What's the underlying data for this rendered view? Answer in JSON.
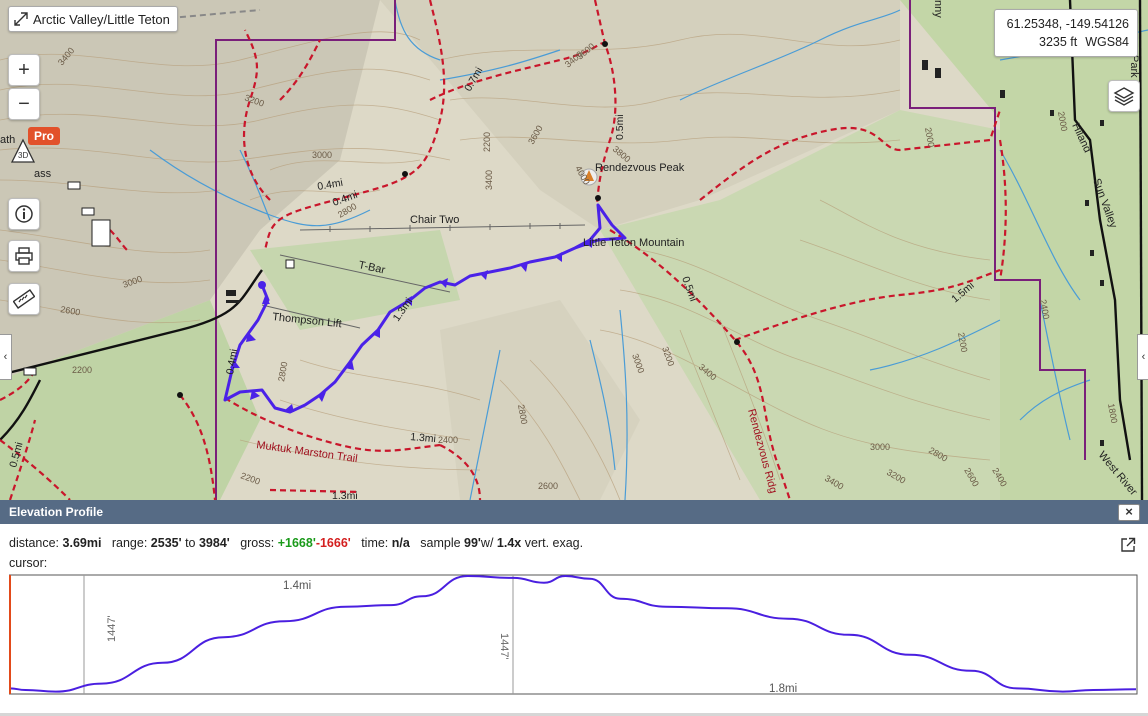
{
  "map": {
    "title": "Arctic Valley/Little Teton",
    "coords": {
      "latlon": "61.25348, -149.54126",
      "elevation": "3235 ft",
      "datum": "WGS84"
    },
    "controls": {
      "zoom_in": "+",
      "zoom_out": "−",
      "pro_badge": "Pro",
      "three_d": "3D"
    },
    "labels": {
      "rendezvous_peak": "Rendezvous Peak",
      "little_teton": "Little Teton Mountain",
      "chair_two": "Chair Two",
      "t_bar": "T-Bar",
      "thompson_lift": "Thompson Lift",
      "muktuk_trail": "Muktuk Marston Trail",
      "rendezvous_ridge": "Rendezvous Ridg",
      "hiland": "Hiland",
      "sun_valley": "Sun Valley",
      "west_river": "West River",
      "nny": "nny",
      "park": "Park",
      "ass": "ass",
      "ath": "ath"
    },
    "distance_labels": [
      "0.7mi",
      "0.5mi",
      "0.4mi",
      "0.4mi",
      "1.3mi",
      "0.4mi",
      "0.5mi",
      "1.5mi",
      "1.3mi",
      "1.3mi",
      "0.5mi"
    ],
    "contour_labels": [
      "3400",
      "3200",
      "3000",
      "2800",
      "3600",
      "3400",
      "3800",
      "4000",
      "3000",
      "2600",
      "2200",
      "2800",
      "3000",
      "3200",
      "3400",
      "2800",
      "2600",
      "2000",
      "2000",
      "2200",
      "2400",
      "1800",
      "3000",
      "2800",
      "2600",
      "2400",
      "2400",
      "3400",
      "3200",
      "2200",
      "2200",
      "3400",
      "3600"
    ]
  },
  "elevation_panel": {
    "title": "Elevation Profile",
    "close": "×",
    "stats": {
      "distance_label": "distance:",
      "distance": "3.69mi",
      "range_label": "range:",
      "range_low": "2535'",
      "range_to": "to",
      "range_high": "3984'",
      "gross_label": "gross:",
      "gain": "+1668'",
      "loss": "-1666'",
      "time_label": "time:",
      "time": "n/a",
      "sample_label": "sample",
      "sample": "99'",
      "sample_w": "w/",
      "exag": "1.4x",
      "exag_label": "vert. exag."
    },
    "cursor_label": "cursor:"
  },
  "chart_data": {
    "type": "line",
    "title": "",
    "xlabel": "",
    "ylabel": "",
    "ylim": [
      2535,
      3984
    ],
    "annotations": {
      "segment1_distance": "1.4mi",
      "segment2_distance": "1.8mi",
      "segment1_gain": "1447'",
      "segment2_gain": "1447'"
    },
    "series": [
      {
        "name": "",
        "x": [
          0,
          0.05,
          0.15,
          0.3,
          0.5,
          0.7,
          0.9,
          1.1,
          1.25,
          1.35,
          1.5,
          1.65,
          1.75,
          1.82,
          1.9,
          2.0,
          2.15,
          2.35,
          2.55,
          2.75,
          2.95,
          3.15,
          3.3,
          3.45,
          3.55,
          3.69
        ],
        "values": [
          2580,
          2560,
          2540,
          2640,
          2900,
          3220,
          3420,
          3600,
          3620,
          3730,
          3984,
          3960,
          3900,
          3984,
          3950,
          3700,
          3600,
          3580,
          3450,
          3250,
          3000,
          2800,
          2580,
          2540,
          2560,
          2570
        ]
      }
    ],
    "cursor_color": "#e24a1a",
    "line_color": "#4a1fe0"
  }
}
